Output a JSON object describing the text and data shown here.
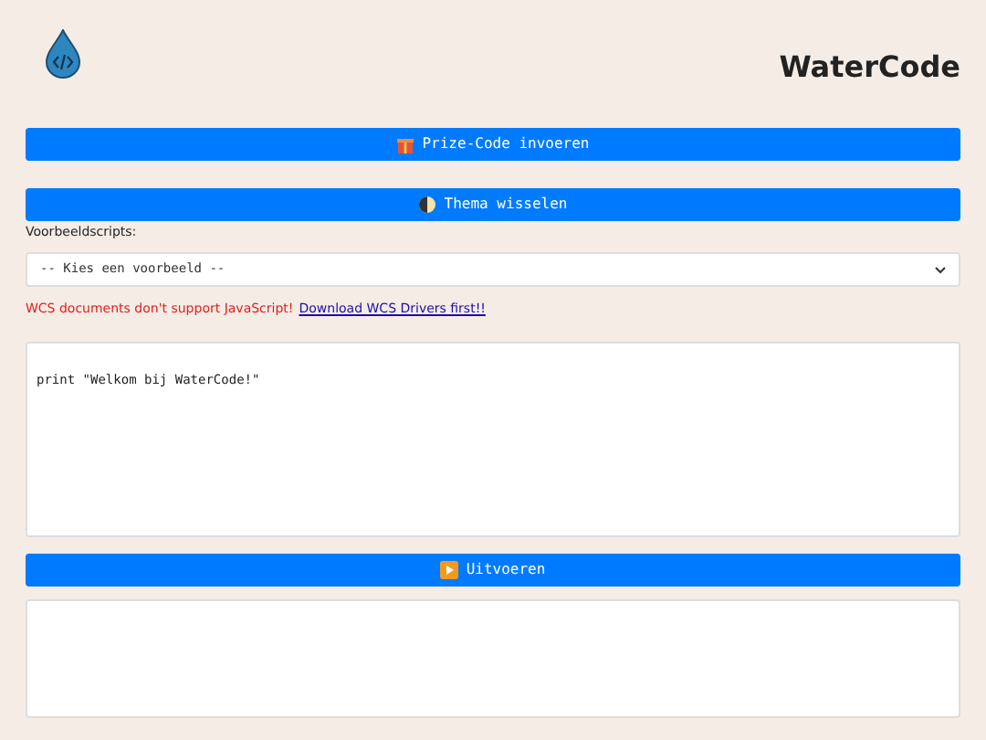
{
  "header": {
    "title": "WaterCode"
  },
  "buttons": [
    {
      "kind": "gift",
      "label": "Prize-Code invoeren"
    },
    {
      "kind": "theme",
      "label": "Thema wisselen"
    }
  ],
  "examples": {
    "label": "Voorbeeldscripts:",
    "value": "-- Kies een voorbeeld --"
  },
  "warning": {
    "text": "WCS documents don't support JavaScript!",
    "link": "Download WCS Drivers first!!"
  },
  "editor": {
    "value": "print \"Welkom bij WaterCode!\""
  },
  "run_button": {
    "kind": "play",
    "label": "Uitvoeren"
  }
}
